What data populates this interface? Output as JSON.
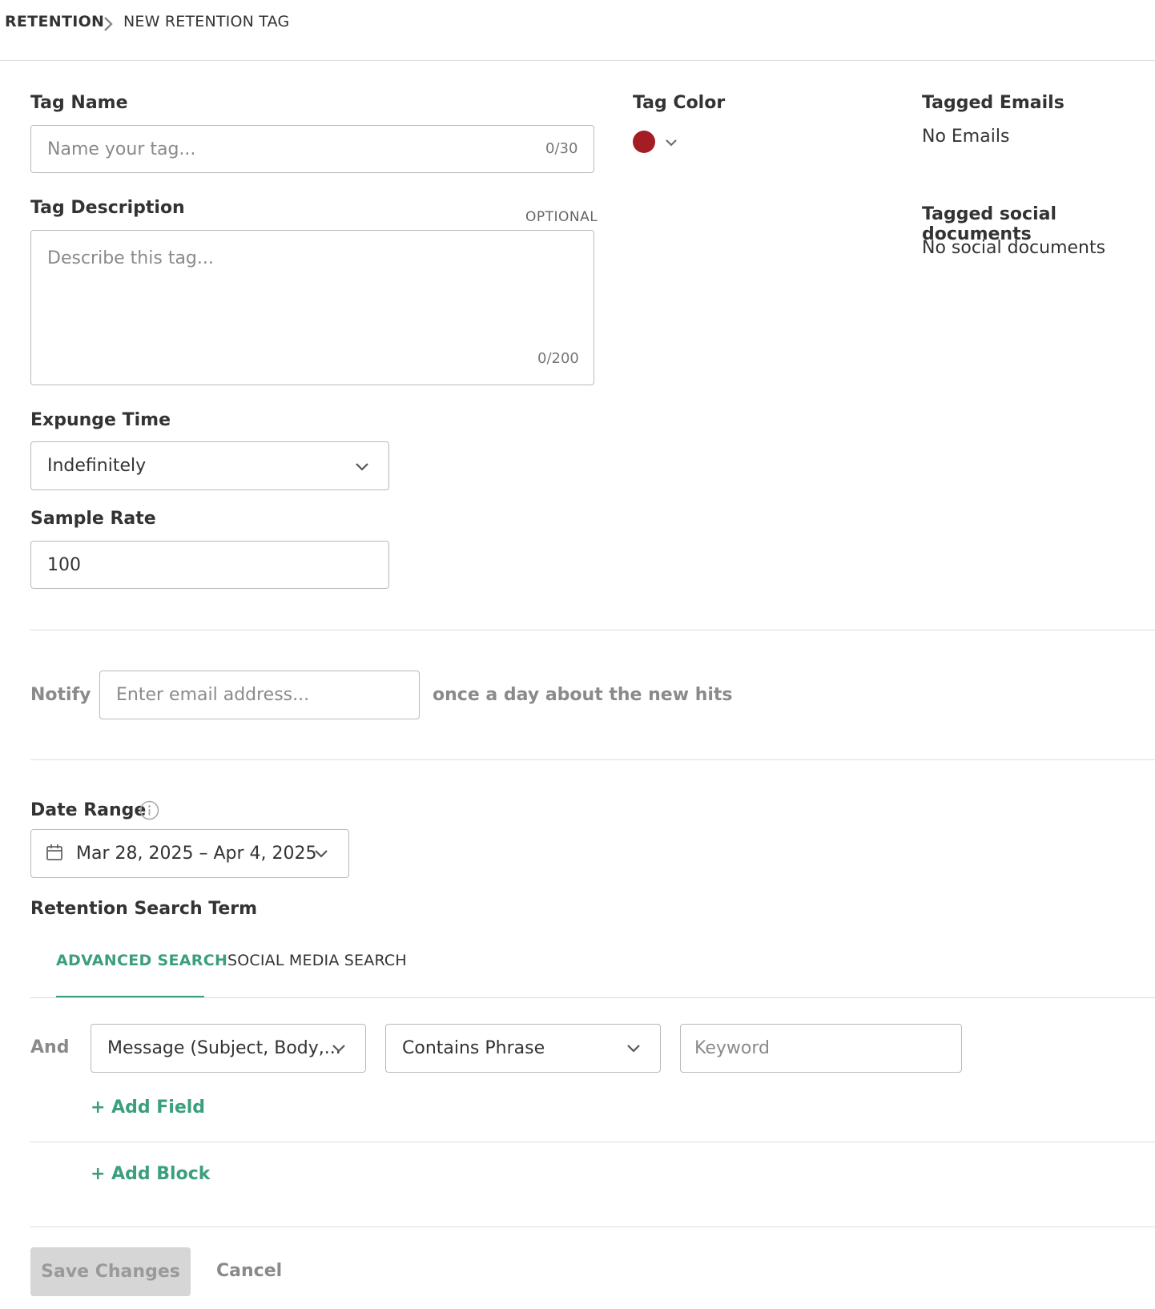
{
  "breadcrumb": {
    "root": "RETENTION",
    "current": "NEW RETENTION TAG"
  },
  "tag_name": {
    "label": "Tag Name",
    "placeholder": "Name your tag...",
    "counter": "0/30"
  },
  "tag_color": {
    "label": "Tag Color",
    "color": "#a51d24"
  },
  "tagged_emails": {
    "label": "Tagged Emails",
    "value": "No Emails"
  },
  "tagged_social": {
    "label": "Tagged social documents",
    "value": "No social documents"
  },
  "tag_description": {
    "label": "Tag Description",
    "optional": "OPTIONAL",
    "placeholder": "Describe this tag...",
    "counter": "0/200"
  },
  "expunge_time": {
    "label": "Expunge Time",
    "value": "Indefinitely"
  },
  "sample_rate": {
    "label": "Sample Rate",
    "value": "100"
  },
  "notify": {
    "label": "Notify",
    "placeholder": "Enter email address...",
    "suffix": "once a day about the new hits"
  },
  "date_range": {
    "label": "Date Range",
    "value": "Mar 28, 2025 – Apr 4, 2025"
  },
  "search_term": {
    "label": "Retention Search Term",
    "tabs": [
      "ADVANCED SEARCH",
      "SOCIAL MEDIA SEARCH"
    ],
    "active_tab": "ADVANCED SEARCH",
    "row": {
      "operator": "And",
      "field": "Message (Subject, Body,...",
      "condition": "Contains Phrase",
      "keyword_placeholder": "Keyword"
    },
    "add_field": "+ Add Field",
    "add_block": "+ Add Block"
  },
  "actions": {
    "save": "Save Changes",
    "cancel": "Cancel"
  },
  "colors": {
    "accent": "#3c9f7c",
    "tag_red": "#a51d24"
  }
}
